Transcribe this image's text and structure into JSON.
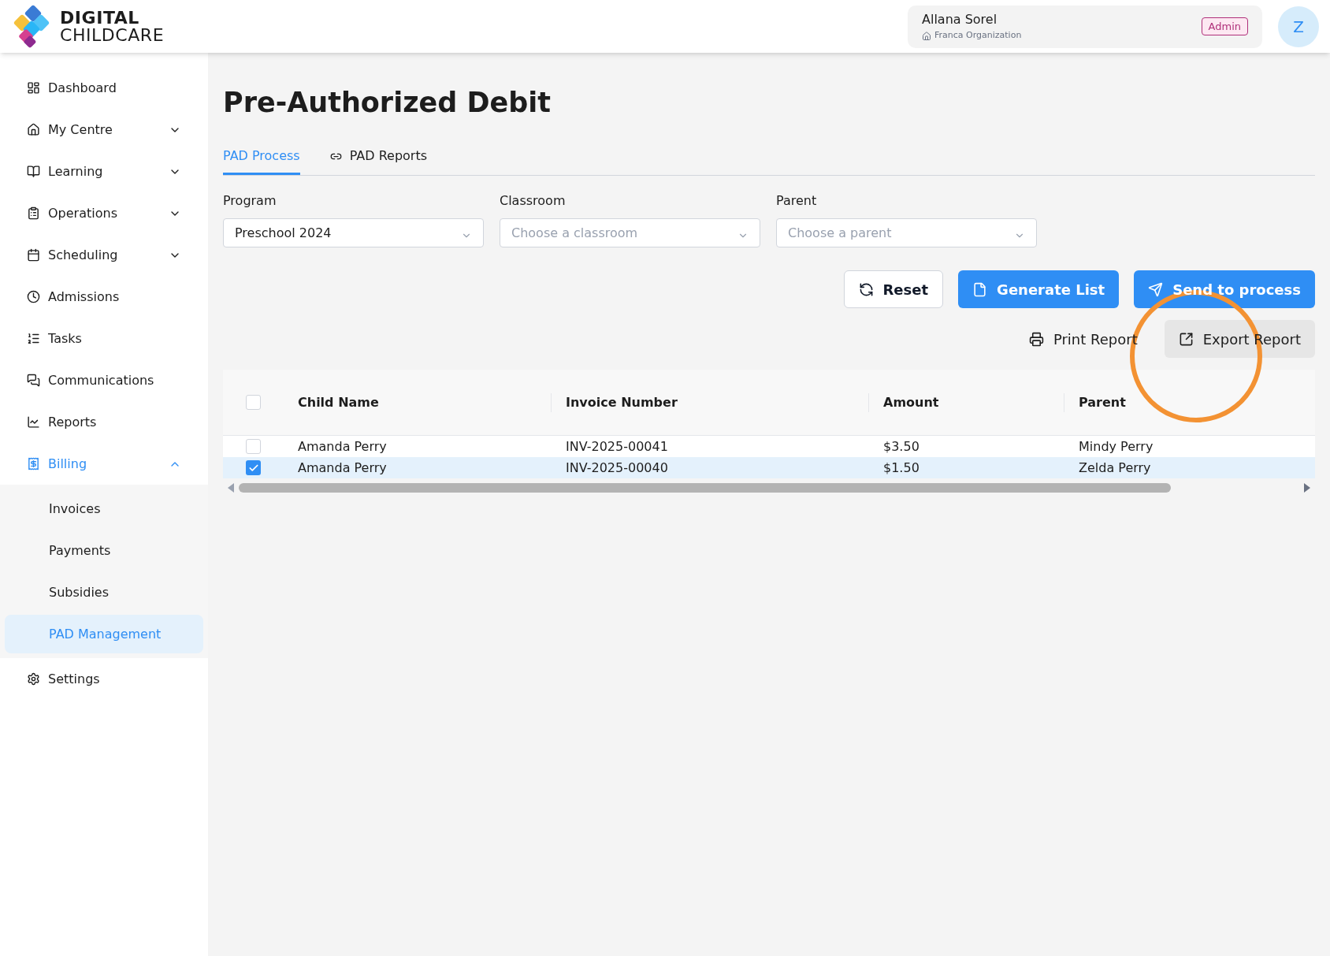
{
  "header": {
    "logo": {
      "line1": "DIGITAL",
      "line2": "CHILDCARE"
    },
    "user": {
      "name": "Allana Sorel",
      "organization": "Franca Organization",
      "role": "Admin",
      "avatar": "Z"
    }
  },
  "sidebar": {
    "items": [
      {
        "label": "Dashboard",
        "kind": "dashboard",
        "selected": false
      },
      {
        "label": "My Centre",
        "kind": "home",
        "selected": false,
        "expanded": false
      },
      {
        "label": "Learning",
        "kind": "book",
        "selected": false,
        "expanded": false
      },
      {
        "label": "Operations",
        "kind": "list-box",
        "selected": false,
        "expanded": false
      },
      {
        "label": "Scheduling",
        "kind": "calendar",
        "selected": false,
        "expanded": false
      },
      {
        "label": "Admissions",
        "kind": "clock",
        "selected": false
      },
      {
        "label": "Tasks",
        "kind": "tasks",
        "selected": false
      },
      {
        "label": "Communications",
        "kind": "chat",
        "selected": false
      },
      {
        "label": "Reports",
        "kind": "chart",
        "selected": false
      },
      {
        "label": "Billing",
        "kind": "billing",
        "selected": true,
        "expanded": true,
        "children": [
          {
            "label": "Invoices",
            "selected": false
          },
          {
            "label": "Payments",
            "selected": false
          },
          {
            "label": "Subsidies",
            "selected": false
          },
          {
            "label": "PAD Management",
            "selected": true
          }
        ]
      },
      {
        "label": "Settings",
        "kind": "settings",
        "selected": false
      }
    ]
  },
  "page": {
    "title": "Pre-Authorized Debit"
  },
  "tabs": [
    {
      "label": "PAD Process",
      "selected": true
    },
    {
      "label": "PAD Reports",
      "selected": false,
      "kind": "link"
    }
  ],
  "filters": [
    {
      "label": "Program",
      "value": "Preschool 2024"
    },
    {
      "label": "Classroom",
      "placeholder": "Choose a classroom"
    },
    {
      "label": "Parent",
      "placeholder": "Choose a parent"
    }
  ],
  "actions": [
    {
      "label": "Reset",
      "kind": "reset"
    },
    {
      "label": "Generate List",
      "kind": "generate"
    },
    {
      "label": "Send to process",
      "kind": "send"
    }
  ],
  "report_actions": [
    {
      "label": "Print Report",
      "kind": "print"
    },
    {
      "label": "Export Report",
      "kind": "export"
    }
  ],
  "table": {
    "select_all": {
      "checked": false
    },
    "columns": [
      "Child Name",
      "Invoice Number",
      "Amount",
      "Parent"
    ],
    "rows": [
      {
        "checked": false,
        "cells": [
          "Amanda Perry",
          "INV-2025-00041",
          "$3.50",
          "Mindy Perry"
        ]
      },
      {
        "checked": true,
        "cells": [
          "Amanda Perry",
          "INV-2025-00040",
          "$1.50",
          "Zelda Perry"
        ]
      }
    ]
  }
}
